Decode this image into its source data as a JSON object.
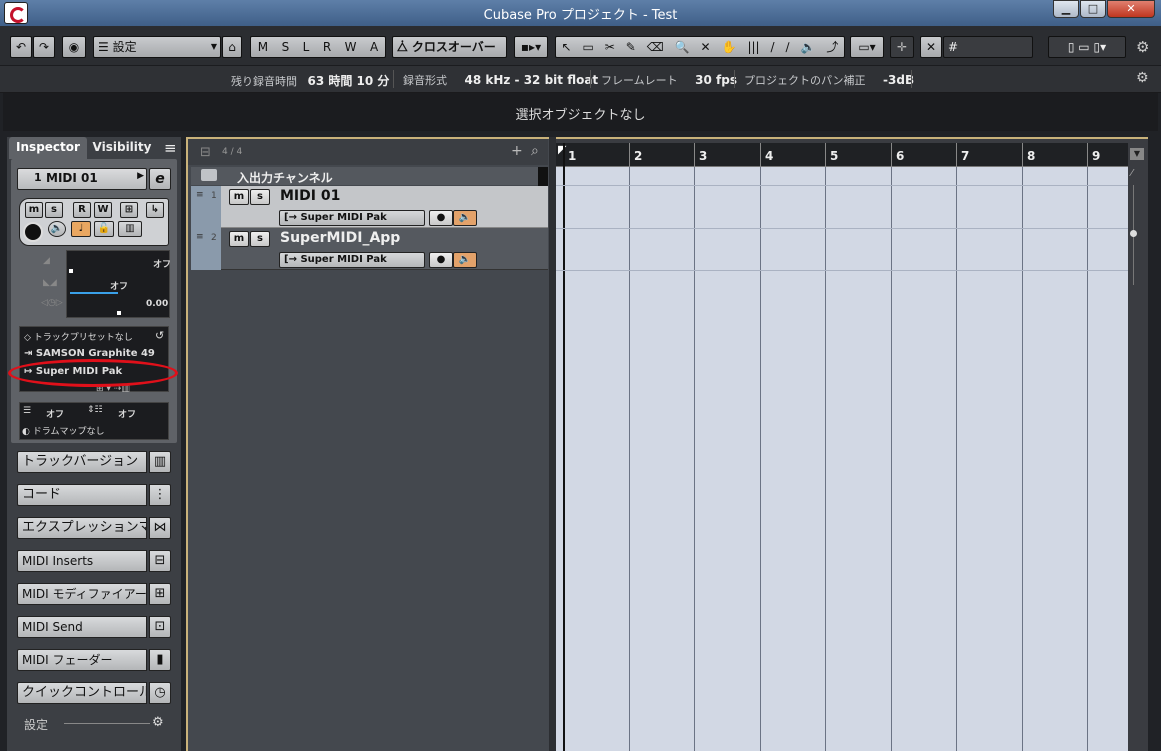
{
  "window": {
    "title": "Cubase Pro プロジェクト - Test",
    "minimize": "▁",
    "maximize": "□",
    "close": "✕"
  },
  "toolbar": {
    "undo": "↶",
    "redo": "↷",
    "activate": "◉",
    "list_icon": "☰",
    "workspace": "設定",
    "modes": [
      "M",
      "S",
      "L",
      "R",
      "W",
      "A"
    ],
    "crossover": "クロスオーバー",
    "tools": [
      "↖",
      "▭",
      "✂",
      "✎",
      "⌫",
      "🔍",
      "✕",
      "✋",
      "|||",
      "/",
      "∕",
      "🔈",
      "⤴"
    ],
    "snap_hash": "#"
  },
  "info": {
    "remaining_label": "残り録音時間",
    "remaining_value": "63 時間 10 分",
    "format_label": "録音形式",
    "format_value": "48 kHz - 32 bit float",
    "framerate_label": "フレームレート",
    "framerate_value": "30 fps",
    "pan_label": "プロジェクトのパン補正",
    "pan_value": "-3dB"
  },
  "status": "選択オブジェクトなし",
  "inspector": {
    "tab_inspector": "Inspector",
    "tab_visibility": "Visibility",
    "menu_icon": "≡",
    "track_number": "1",
    "track_name": "MIDI 01",
    "edit_icon": "e",
    "mute": "m",
    "solo": "s",
    "read": "R",
    "write": "W",
    "volume_value": "オフ",
    "pan_value": "オフ",
    "delay_value": "0.00",
    "preset": "トラックプリセットなし",
    "input": "SAMSON Graphite 49",
    "output": "Super MIDI Pak",
    "program_value": "オフ",
    "bank_value": "オフ",
    "drummap": "ドラムマップなし",
    "panels": [
      {
        "label": "トラックバージョン",
        "icon": "▥"
      },
      {
        "label": "コード",
        "icon": "⋮"
      },
      {
        "label": "エクスプレッションマ",
        "icon": "⋈"
      },
      {
        "label": "MIDI Inserts",
        "icon": "⊟"
      },
      {
        "label": "MIDI モディファイアー",
        "icon": "⊞"
      },
      {
        "label": "MIDI Send",
        "icon": "⊡"
      },
      {
        "label": "MIDI フェーダー",
        "icon": "▮"
      },
      {
        "label": "クイックコントロール",
        "icon": "◷"
      }
    ],
    "settings_label": "設定"
  },
  "tracklist": {
    "count": "4 / 4",
    "add": "+",
    "search": "⌕",
    "folder_label": "入出力チャンネル",
    "tracks": [
      {
        "num": "1",
        "name": "MIDI 01",
        "output": "Super MIDI Pak"
      },
      {
        "num": "2",
        "name": "SuperMIDI_App",
        "output": "Super MIDI Pak"
      }
    ]
  },
  "ruler": {
    "bars": [
      "1",
      "2",
      "3",
      "4",
      "5",
      "6",
      "7",
      "8",
      "9"
    ]
  },
  "annotation_color": "#e0101a"
}
